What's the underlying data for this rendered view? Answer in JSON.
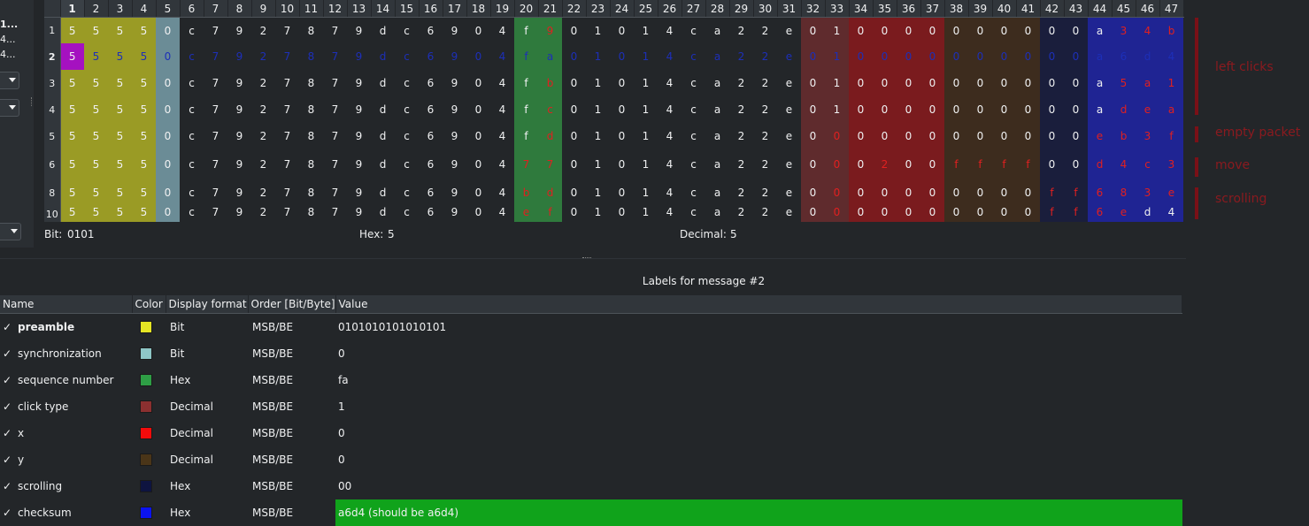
{
  "left_panel": {
    "lines": [
      "1...",
      "4...",
      "4..."
    ]
  },
  "protocol": {
    "columns": [
      "1",
      "2",
      "3",
      "4",
      "5",
      "6",
      "7",
      "8",
      "9",
      "10",
      "11",
      "12",
      "13",
      "14",
      "15",
      "16",
      "17",
      "18",
      "19",
      "20",
      "21",
      "22",
      "23",
      "24",
      "25",
      "26",
      "27",
      "28",
      "29",
      "30",
      "31",
      "32",
      "33",
      "34",
      "35",
      "36",
      "37",
      "38",
      "39",
      "40",
      "41",
      "42",
      "43",
      "44",
      "45",
      "46",
      "47"
    ],
    "selected_column": 0,
    "column_colors": [
      "#9a9b25",
      "#9a9b25",
      "#9a9b25",
      "#9a9b25",
      "#6b8c96",
      null,
      null,
      null,
      null,
      null,
      null,
      null,
      null,
      null,
      null,
      null,
      null,
      null,
      null,
      "#2f7a3d",
      "#2f7a3d",
      null,
      null,
      null,
      null,
      null,
      null,
      null,
      null,
      null,
      null,
      "#5f2b2d",
      "#5f2b2d",
      "#7a1b1e",
      "#7a1b1e",
      "#7a1b1e",
      "#7a1b1e",
      "#3d2c1e",
      "#3d2c1e",
      "#3d2c1e",
      "#3d2c1e",
      "#1a1e3c",
      "#1a1e3c",
      "#1f2493",
      "#1f2493",
      "#1f2493",
      "#1f2493"
    ],
    "rows": [
      {
        "label": "1",
        "selected": false,
        "cells": [
          "5",
          "5",
          "5",
          "5",
          "0",
          "c",
          "7",
          "9",
          "2",
          "7",
          "8",
          "7",
          "9",
          "d",
          "c",
          "6",
          "9",
          "0",
          "4",
          "f",
          "9",
          "0",
          "1",
          "0",
          "1",
          "4",
          "c",
          "a",
          "2",
          "2",
          "e",
          "0",
          "1",
          "0",
          "0",
          "0",
          "0",
          "0",
          "0",
          "0",
          "0",
          "0",
          "0",
          "a",
          "3",
          "4",
          "b"
        ],
        "diff": [
          20,
          44,
          45,
          46
        ]
      },
      {
        "label": "2",
        "selected": true,
        "cells": [
          "5",
          "5",
          "5",
          "5",
          "0",
          "c",
          "7",
          "9",
          "2",
          "7",
          "8",
          "7",
          "9",
          "d",
          "c",
          "6",
          "9",
          "0",
          "4",
          "f",
          "a",
          "0",
          "1",
          "0",
          "1",
          "4",
          "c",
          "a",
          "2",
          "2",
          "e",
          "0",
          "1",
          "0",
          "0",
          "0",
          "0",
          "0",
          "0",
          "0",
          "0",
          "0",
          "0",
          "a",
          "6",
          "d",
          "4"
        ],
        "diff": []
      },
      {
        "label": "3",
        "selected": false,
        "cells": [
          "5",
          "5",
          "5",
          "5",
          "0",
          "c",
          "7",
          "9",
          "2",
          "7",
          "8",
          "7",
          "9",
          "d",
          "c",
          "6",
          "9",
          "0",
          "4",
          "f",
          "b",
          "0",
          "1",
          "0",
          "1",
          "4",
          "c",
          "a",
          "2",
          "2",
          "e",
          "0",
          "1",
          "0",
          "0",
          "0",
          "0",
          "0",
          "0",
          "0",
          "0",
          "0",
          "0",
          "a",
          "5",
          "a",
          "1"
        ],
        "diff": [
          20,
          44,
          45,
          46
        ]
      },
      {
        "label": "4",
        "selected": false,
        "cells": [
          "5",
          "5",
          "5",
          "5",
          "0",
          "c",
          "7",
          "9",
          "2",
          "7",
          "8",
          "7",
          "9",
          "d",
          "c",
          "6",
          "9",
          "0",
          "4",
          "f",
          "c",
          "0",
          "1",
          "0",
          "1",
          "4",
          "c",
          "a",
          "2",
          "2",
          "e",
          "0",
          "1",
          "0",
          "0",
          "0",
          "0",
          "0",
          "0",
          "0",
          "0",
          "0",
          "0",
          "a",
          "d",
          "e",
          "a"
        ],
        "diff": [
          20,
          44,
          45,
          46
        ]
      },
      {
        "label": "5",
        "selected": false,
        "cells": [
          "5",
          "5",
          "5",
          "5",
          "0",
          "c",
          "7",
          "9",
          "2",
          "7",
          "8",
          "7",
          "9",
          "d",
          "c",
          "6",
          "9",
          "0",
          "4",
          "f",
          "d",
          "0",
          "1",
          "0",
          "1",
          "4",
          "c",
          "a",
          "2",
          "2",
          "e",
          "0",
          "0",
          "0",
          "0",
          "0",
          "0",
          "0",
          "0",
          "0",
          "0",
          "0",
          "0",
          "e",
          "b",
          "3",
          "f"
        ],
        "diff": [
          20,
          32,
          43,
          44,
          45,
          46
        ]
      },
      {
        "label": "6",
        "selected": false,
        "cells": [
          "5",
          "5",
          "5",
          "5",
          "0",
          "c",
          "7",
          "9",
          "2",
          "7",
          "8",
          "7",
          "9",
          "d",
          "c",
          "6",
          "9",
          "0",
          "4",
          "7",
          "7",
          "0",
          "1",
          "0",
          "1",
          "4",
          "c",
          "a",
          "2",
          "2",
          "e",
          "0",
          "0",
          "0",
          "2",
          "0",
          "0",
          "f",
          "f",
          "f",
          "f",
          "0",
          "0",
          "d",
          "4",
          "c",
          "3"
        ],
        "diff": [
          19,
          20,
          32,
          34,
          37,
          38,
          39,
          40,
          43,
          44,
          45,
          46
        ]
      },
      {
        "label": "8",
        "selected": false,
        "cells": [
          "5",
          "5",
          "5",
          "5",
          "0",
          "c",
          "7",
          "9",
          "2",
          "7",
          "8",
          "7",
          "9",
          "d",
          "c",
          "6",
          "9",
          "0",
          "4",
          "b",
          "d",
          "0",
          "1",
          "0",
          "1",
          "4",
          "c",
          "a",
          "2",
          "2",
          "e",
          "0",
          "0",
          "0",
          "0",
          "0",
          "0",
          "0",
          "0",
          "0",
          "0",
          "f",
          "f",
          "6",
          "8",
          "3",
          "e"
        ],
        "diff": [
          19,
          20,
          32,
          41,
          42,
          43,
          44,
          45,
          46
        ]
      },
      {
        "label": "10",
        "selected": false,
        "cells": [
          "5",
          "5",
          "5",
          "5",
          "0",
          "c",
          "7",
          "9",
          "2",
          "7",
          "8",
          "7",
          "9",
          "d",
          "c",
          "6",
          "9",
          "0",
          "4",
          "e",
          "f",
          "0",
          "1",
          "0",
          "1",
          "4",
          "c",
          "a",
          "2",
          "2",
          "e",
          "0",
          "0",
          "0",
          "0",
          "0",
          "0",
          "0",
          "0",
          "0",
          "0",
          "f",
          "f",
          "6",
          "e",
          "d",
          "4"
        ],
        "diff": [
          19,
          20,
          32,
          41,
          42,
          43,
          44
        ]
      }
    ],
    "cursor": {
      "row": 1,
      "col": 0
    }
  },
  "annotations": [
    {
      "text": "left clicks"
    },
    {
      "text": "empty packet"
    },
    {
      "text": "move"
    },
    {
      "text": "scrolling"
    }
  ],
  "status": {
    "bit_label": "Bit:",
    "bit_value": "0101",
    "hex_label": "Hex:",
    "hex_value": "5",
    "decimal_label": "Decimal:",
    "decimal_value": "5"
  },
  "labels_panel": {
    "title": "Labels for message #2",
    "headers": [
      "Name",
      "Color",
      "Display format",
      "Order [Bit/Byte]",
      "Value"
    ],
    "check_glyph": "✓",
    "rows": [
      {
        "name": "preamble",
        "bold": true,
        "color": "#e5e524",
        "format": "Bit",
        "order": "MSB/BE",
        "value": "0101010101010101",
        "ok": false
      },
      {
        "name": "synchronization",
        "bold": false,
        "color": "#8ec6c6",
        "format": "Bit",
        "order": "MSB/BE",
        "value": "0",
        "ok": false
      },
      {
        "name": "sequence number",
        "bold": false,
        "color": "#2e9e45",
        "format": "Hex",
        "order": "MSB/BE",
        "value": "fa",
        "ok": false
      },
      {
        "name": "click type",
        "bold": false,
        "color": "#8b3030",
        "format": "Decimal",
        "order": "MSB/BE",
        "value": "1",
        "ok": false
      },
      {
        "name": "x",
        "bold": false,
        "color": "#f20b0b",
        "format": "Decimal",
        "order": "MSB/BE",
        "value": "0",
        "ok": false
      },
      {
        "name": "y",
        "bold": false,
        "color": "#4a3518",
        "format": "Decimal",
        "order": "MSB/BE",
        "value": "0",
        "ok": false
      },
      {
        "name": "scrolling",
        "bold": false,
        "color": "#0e1440",
        "format": "Hex",
        "order": "MSB/BE",
        "value": "00",
        "ok": false
      },
      {
        "name": "checksum",
        "bold": false,
        "color": "#0b13f0",
        "format": "Hex",
        "order": "MSB/BE",
        "value": "a6d4 (should be a6d4)",
        "ok": true
      }
    ]
  }
}
